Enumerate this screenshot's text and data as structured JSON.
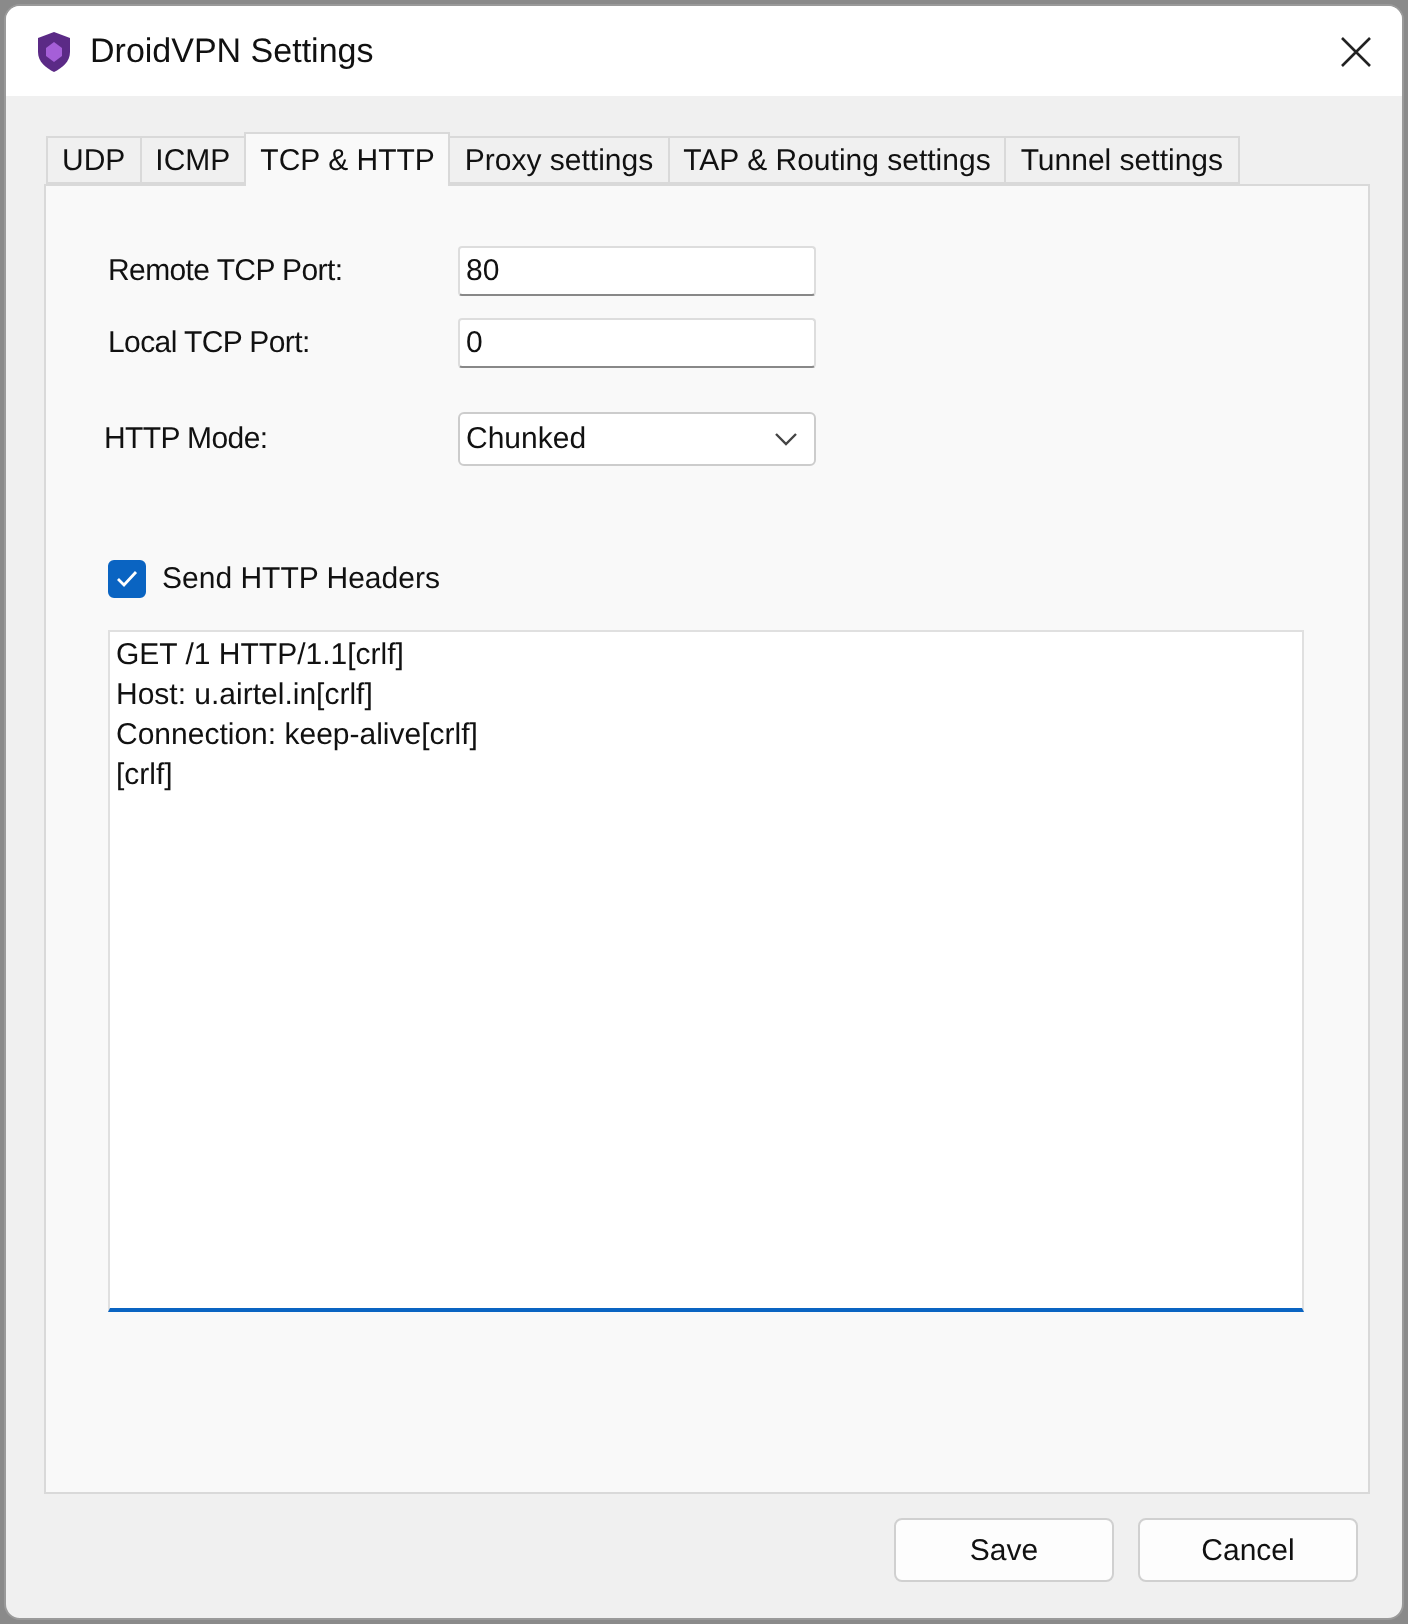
{
  "window": {
    "title": "DroidVPN Settings"
  },
  "tabs": [
    {
      "label": "UDP",
      "selected": false
    },
    {
      "label": "ICMP",
      "selected": false
    },
    {
      "label": "TCP & HTTP",
      "selected": true
    },
    {
      "label": "Proxy settings",
      "selected": false
    },
    {
      "label": "TAP & Routing settings",
      "selected": false
    },
    {
      "label": "Tunnel settings",
      "selected": false
    }
  ],
  "fields": [
    {
      "label": "Remote TCP Port:",
      "value": "80"
    },
    {
      "label": "Local TCP Port:",
      "value": "0"
    }
  ],
  "http_mode": {
    "label": "HTTP Mode:",
    "value": "Chunked"
  },
  "send_headers": {
    "label": "Send HTTP Headers",
    "checked": true
  },
  "headers": {
    "value": "GET /1 HTTP/1.1[crlf]\nHost: u.airtel.in[crlf]\nConnection: keep-alive[crlf]\n[crlf]"
  },
  "buttons": [
    "Save",
    "Cancel"
  ]
}
